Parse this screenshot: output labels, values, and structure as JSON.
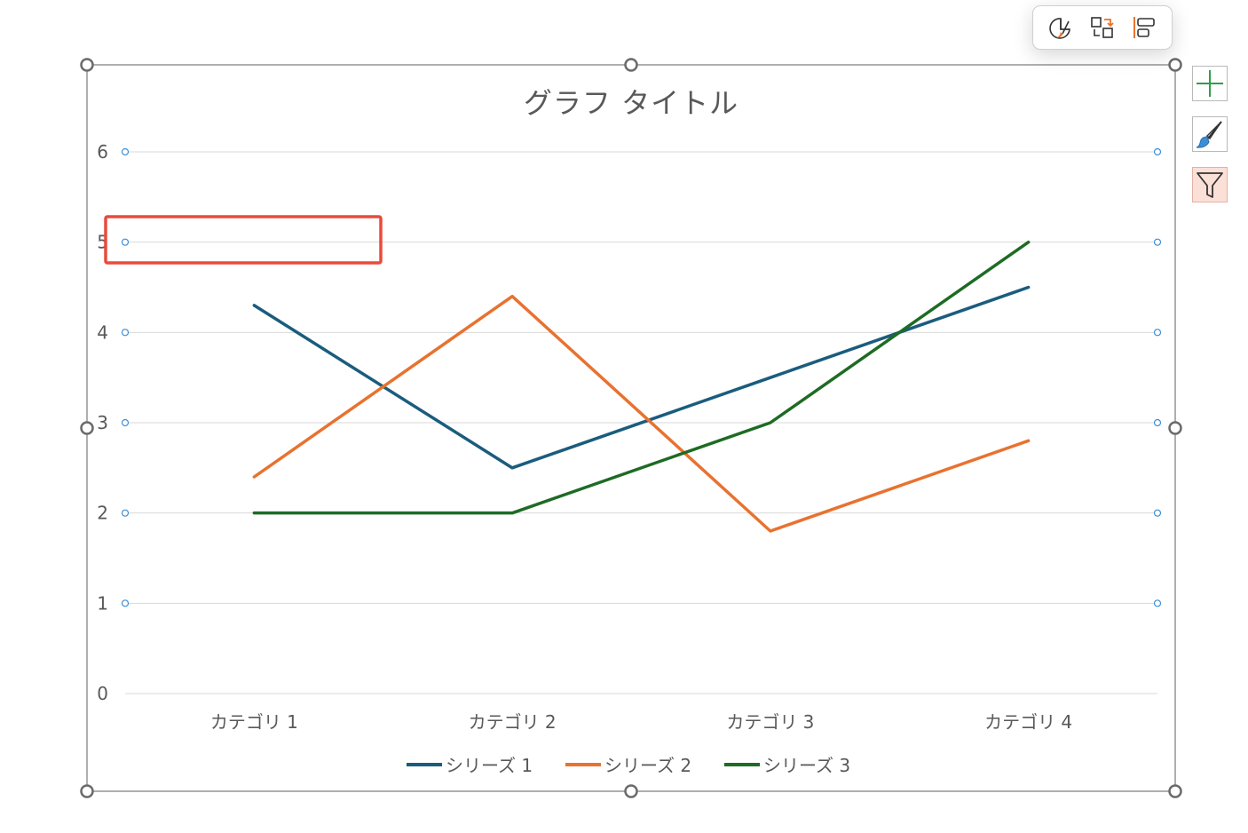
{
  "toolbar": {
    "buttons": [
      {
        "icon": "chart-style-icon"
      },
      {
        "icon": "switch-row-column-icon"
      },
      {
        "icon": "align-icon"
      }
    ]
  },
  "side_buttons": [
    {
      "icon": "add-chart-element-icon",
      "color": "#2e9e4a"
    },
    {
      "icon": "chart-styles-brush-icon",
      "color": "#3b8fd6"
    },
    {
      "icon": "chart-filter-icon",
      "color": "#333333",
      "active": true
    }
  ],
  "colors": {
    "series1": "#1b5c7e",
    "series2": "#e8722f",
    "series3": "#1e6b24",
    "highlight": "#e84b3c",
    "gridline": "#d9d9d9",
    "handle_dot": "#3d8fd8"
  },
  "chart_data": {
    "type": "line",
    "title": "グラフ タイトル",
    "categories": [
      "カテゴリ 1",
      "カテゴリ 2",
      "カテゴリ 3",
      "カテゴリ 4"
    ],
    "series": [
      {
        "name": "シリーズ 1",
        "values": [
          4.3,
          2.5,
          3.5,
          4.5
        ]
      },
      {
        "name": "シリーズ 2",
        "values": [
          2.4,
          4.4,
          1.8,
          2.8
        ]
      },
      {
        "name": "シリーズ 3",
        "values": [
          2,
          2,
          3,
          5
        ]
      }
    ],
    "yticks": [
      "0",
      "1",
      "2",
      "3",
      "4",
      "5",
      "6"
    ],
    "ylim": [
      0,
      6
    ],
    "grid": true,
    "legend_position": "bottom"
  }
}
